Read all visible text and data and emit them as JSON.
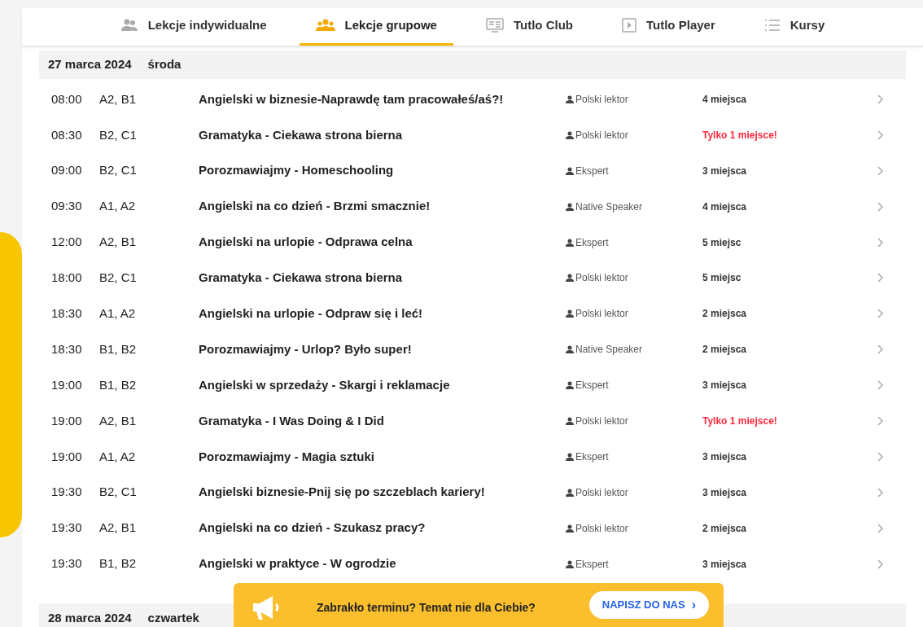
{
  "tabs": [
    {
      "label": "Lekcje indywidualne",
      "kind": "people",
      "selected": false
    },
    {
      "label": "Lekcje grupowe",
      "kind": "group",
      "selected": true
    },
    {
      "label": "Tutlo Club",
      "kind": "screen",
      "selected": false
    },
    {
      "label": "Tutlo Player",
      "kind": "play",
      "selected": false
    },
    {
      "label": "Kursy",
      "kind": "list",
      "selected": false
    }
  ],
  "days": [
    {
      "date": "27 marca 2024",
      "weekday": "środa",
      "lessons": [
        {
          "time": "08:00",
          "levels": "A2, B1",
          "title": "Angielski w biznesie-Naprawdę tam pracowałeś/aś?!",
          "teacher": "Polski lektor",
          "seats": "4 miejsca",
          "last_seat": false
        },
        {
          "time": "08:30",
          "levels": "B2, C1",
          "title": "Gramatyka - Ciekawa strona bierna",
          "teacher": "Polski lektor",
          "seats": "Tylko 1 miejsce!",
          "last_seat": true
        },
        {
          "time": "09:00",
          "levels": "B2, C1",
          "title": "Porozmawiajmy - Homeschooling",
          "teacher": "Ekspert",
          "seats": "3 miejsca",
          "last_seat": false
        },
        {
          "time": "09:30",
          "levels": "A1, A2",
          "title": "Angielski na co dzień - Brzmi smacznie!",
          "teacher": "Native Speaker",
          "seats": "4 miejsca",
          "last_seat": false
        },
        {
          "time": "12:00",
          "levels": "A2, B1",
          "title": "Angielski na urlopie - Odprawa celna",
          "teacher": "Ekspert",
          "seats": "5 miejsc",
          "last_seat": false
        },
        {
          "time": "18:00",
          "levels": "B2, C1",
          "title": "Gramatyka - Ciekawa strona bierna",
          "teacher": "Polski lektor",
          "seats": "5 miejsc",
          "last_seat": false
        },
        {
          "time": "18:30",
          "levels": "A1, A2",
          "title": "Angielski na urlopie - Odpraw się i leć!",
          "teacher": "Polski lektor",
          "seats": "2 miejsca",
          "last_seat": false
        },
        {
          "time": "18:30",
          "levels": "B1, B2",
          "title": "Porozmawiajmy - Urlop? Było super!",
          "teacher": "Native Speaker",
          "seats": "2 miejsca",
          "last_seat": false
        },
        {
          "time": "19:00",
          "levels": "B1, B2",
          "title": "Angielski w sprzedaży - Skargi i reklamacje",
          "teacher": "Ekspert",
          "seats": "3 miejsca",
          "last_seat": false
        },
        {
          "time": "19:00",
          "levels": "A2, B1",
          "title": "Gramatyka - I Was Doing & I Did",
          "teacher": "Polski lektor",
          "seats": "Tylko 1 miejsce!",
          "last_seat": true
        },
        {
          "time": "19:00",
          "levels": "A1, A2",
          "title": "Porozmawiajmy - Magia sztuki",
          "teacher": "Ekspert",
          "seats": "3 miejsca",
          "last_seat": false
        },
        {
          "time": "19:30",
          "levels": "B2, C1",
          "title": "Angielski biznesie-Pnij się po szczeblach kariery!",
          "teacher": "Polski lektor",
          "seats": "3 miejsca",
          "last_seat": false
        },
        {
          "time": "19:30",
          "levels": "A2, B1",
          "title": "Angielski na co dzień - Szukasz pracy?",
          "teacher": "Polski lektor",
          "seats": "2 miejsca",
          "last_seat": false
        },
        {
          "time": "19:30",
          "levels": "B1, B2",
          "title": "Angielski w praktyce - W ogrodzie",
          "teacher": "Ekspert",
          "seats": "3 miejsca",
          "last_seat": false
        }
      ]
    },
    {
      "date": "28 marca 2024",
      "weekday": "czwartek"
    }
  ],
  "banner": {
    "text": "Zabrakło terminu? Temat nie dla Ciebie?",
    "button": "NAPISZ DO NAS",
    "button_icon": "›"
  }
}
